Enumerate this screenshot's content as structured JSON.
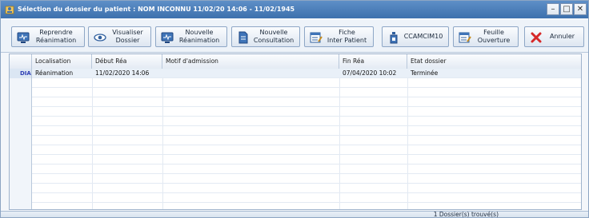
{
  "window": {
    "title": "Sélection du dossier du patient : NOM INCONNU 11/02/20 14:06 - 11/02/1945",
    "minimize": "–",
    "maximize": "□",
    "close": "✕"
  },
  "toolbar": {
    "reprendre": "Reprendre\nRéanimation",
    "visualiser": "Visualiser\nDossier",
    "nouvelle_rea": "Nouvelle\nRéanimation",
    "nouvelle_consult": "Nouvelle\nConsultation",
    "fiche": "Fiche\nInter Patient",
    "ccamcim": "CCAMCIM10",
    "feuille": "Feuille\nOuverture",
    "annuler": "Annuler"
  },
  "grid": {
    "columns": [
      "Localisation",
      "Début Réa",
      "Motif d'admission",
      "Fin Réa",
      "Etat dossier"
    ],
    "rows": [
      {
        "tag": "DIA",
        "localisation": "Réanimation",
        "debut": "11/02/2020 14:06",
        "motif": "",
        "fin": "07/04/2020 10:02",
        "etat": "Terminée"
      }
    ]
  },
  "status": {
    "count": "1 Dossier(s) trouvé(s)"
  },
  "colors": {
    "titlebar": "#3d70ad",
    "cancel_icon": "#d62828",
    "dia_tag": "#2f3fb5"
  }
}
